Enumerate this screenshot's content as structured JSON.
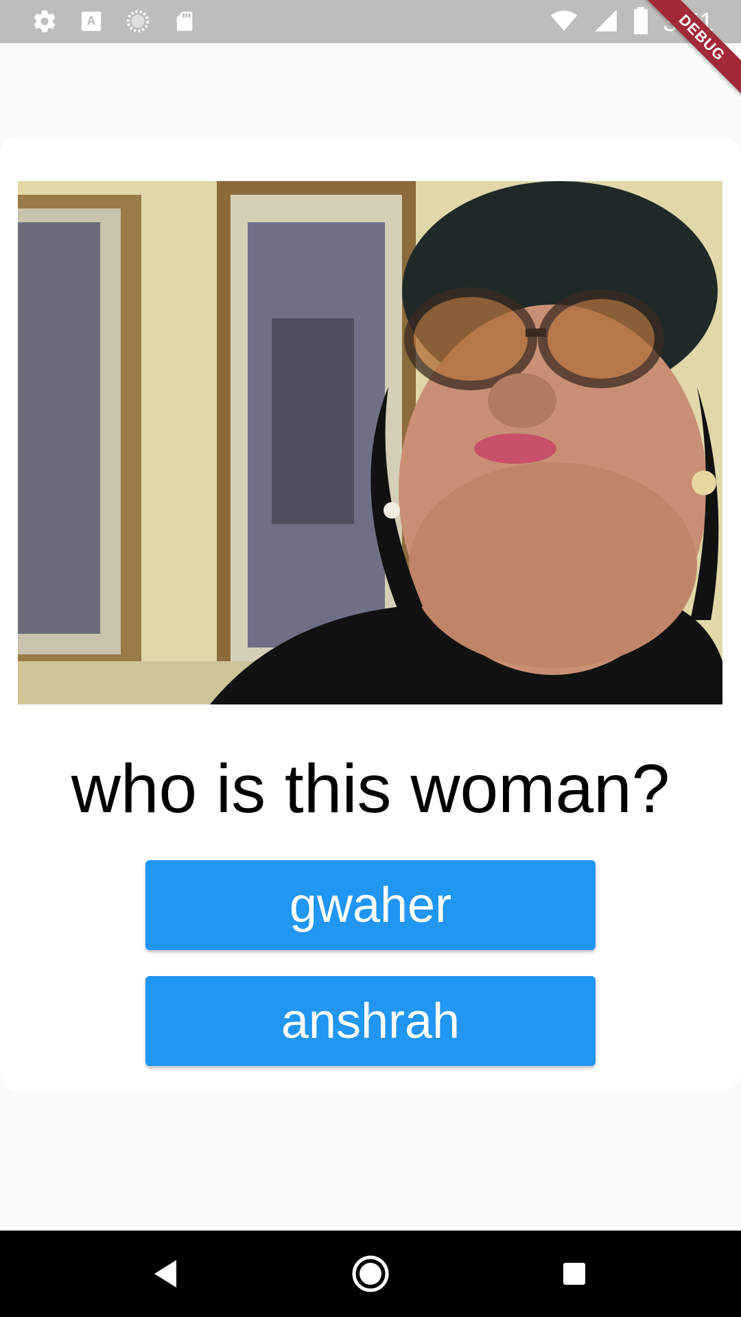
{
  "status_bar": {
    "time": "3:51",
    "icons_left": [
      "settings-icon",
      "font-a-icon",
      "loading-circle-icon",
      "sd-card-icon"
    ],
    "icons_right": [
      "wifi-icon",
      "cell-signal-icon",
      "battery-icon"
    ]
  },
  "debug_banner": {
    "label": "DEBUG",
    "color": "#a32838"
  },
  "quiz": {
    "photo_description": "photo",
    "question": "who is this woman?",
    "answers": [
      {
        "label": "gwaher"
      },
      {
        "label": "anshrah"
      }
    ]
  },
  "nav_bar": {
    "buttons": [
      "back-icon",
      "home-icon",
      "recents-icon"
    ]
  },
  "colors": {
    "status_bar": "#bdbdbd",
    "button": "#2196f3",
    "background": "#fafafa",
    "nav_bar": "#000000"
  }
}
